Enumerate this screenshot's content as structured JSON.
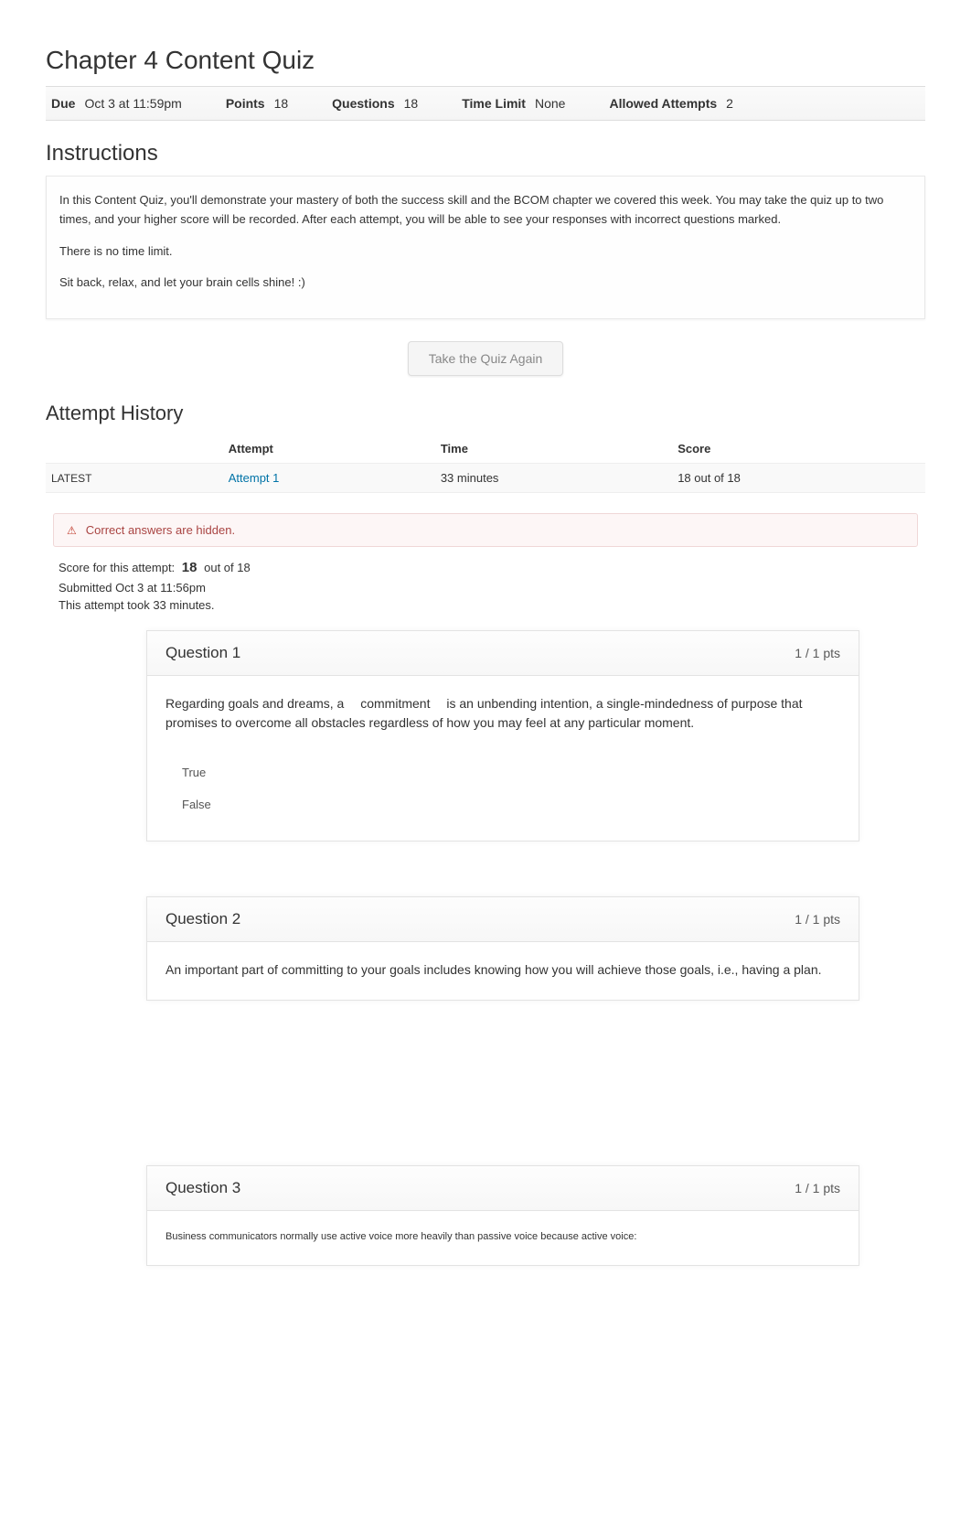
{
  "quiz": {
    "title": "Chapter 4 Content Quiz",
    "meta": {
      "due_label": "Due",
      "due_value": "Oct 3 at 11:59pm",
      "points_label": "Points",
      "points_value": "18",
      "questions_label": "Questions",
      "questions_value": "18",
      "time_limit_label": "Time Limit",
      "time_limit_value": "None",
      "allowed_attempts_label": "Allowed Attempts",
      "allowed_attempts_value": "2"
    }
  },
  "instructions": {
    "heading": "Instructions",
    "p1": "In this Content Quiz, you'll demonstrate your mastery of both the success skill and the BCOM chapter we covered this week. You may take the quiz up to two times, and your higher score will be recorded. After each attempt, you will be able to see your responses with incorrect questions marked.",
    "p2": "There is no time limit.",
    "p3": "Sit back, relax, and let your brain cells shine! :)"
  },
  "take_again_label": "Take the Quiz Again",
  "history": {
    "heading": "Attempt History",
    "cols": {
      "blank": "",
      "attempt": "Attempt",
      "time": "Time",
      "score": "Score"
    },
    "rows": [
      {
        "latest": "LATEST",
        "attempt": "Attempt 1",
        "time": "33 minutes",
        "score": "18 out of 18"
      }
    ]
  },
  "banner": {
    "text": "Correct answers are hidden."
  },
  "summary": {
    "score_label": "Score for this attempt:",
    "score_value": "18",
    "score_suffix": "out of 18",
    "submitted": "Submitted Oct 3 at 11:56pm",
    "duration": "This attempt took 33 minutes."
  },
  "questions": [
    {
      "title": "Question 1",
      "pts": "1 / 1 pts",
      "text": "Regarding goals and dreams, a  commitment  is an unbending intention, a single-mindedness of purpose that promises to overcome all obstacles regardless of how you may feel at any particular moment.",
      "answers": [
        "True",
        "False"
      ]
    },
    {
      "title": "Question 2",
      "pts": "1 / 1 pts",
      "text": "An important part of committing to your goals includes knowing how you will achieve those goals, i.e., having a plan.",
      "answers": []
    },
    {
      "title": "Question 3",
      "pts": "1 / 1 pts",
      "text": "Business communicators normally use active voice more heavily than passive voice because active voice:",
      "answers": []
    }
  ]
}
